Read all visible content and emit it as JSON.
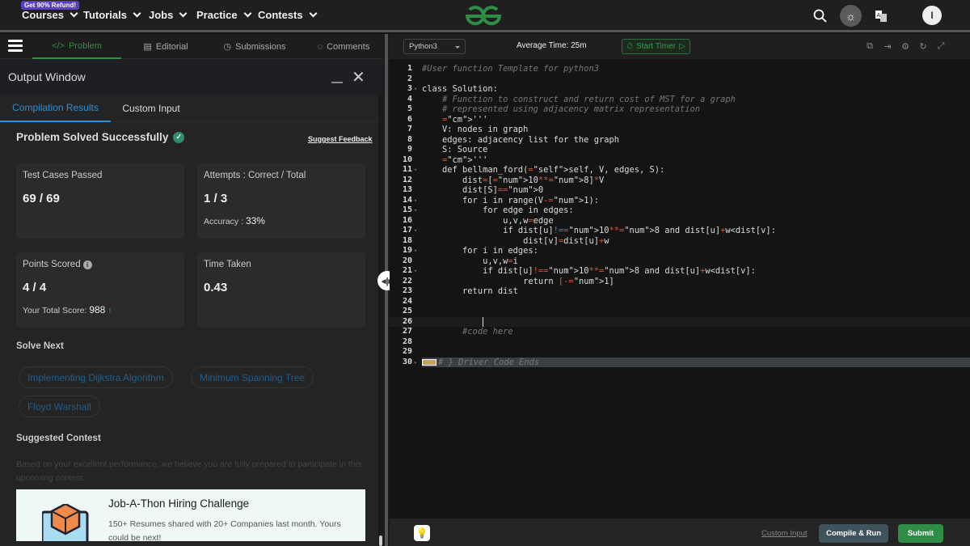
{
  "topnav": {
    "badge": "Get 90% Refund!",
    "items": [
      {
        "label": "Courses"
      },
      {
        "label": "Tutorials"
      },
      {
        "label": "Jobs"
      },
      {
        "label": "Practice"
      },
      {
        "label": "Contests"
      }
    ],
    "avatar_initial": "I",
    "brand_color": "#2f8d46"
  },
  "problem_tabs": [
    {
      "label": "Problem",
      "icon": "code-icon",
      "active": true
    },
    {
      "label": "Editorial",
      "icon": "document-icon"
    },
    {
      "label": "Submissions",
      "icon": "clock-icon"
    },
    {
      "label": "Comments",
      "icon": "comment-icon"
    }
  ],
  "output_window": {
    "title": "Output Window",
    "tabs": [
      {
        "label": "Compilation Results",
        "active": true
      },
      {
        "label": "Custom Input"
      }
    ],
    "status": "Problem Solved Successfully",
    "suggest_feedback": "Suggest Feedback",
    "cards": {
      "test_cases": {
        "label": "Test Cases Passed",
        "value": "69 / 69"
      },
      "attempts": {
        "label": "Attempts : Correct / Total",
        "value": "1 / 3",
        "accuracy_label": "Accuracy :",
        "accuracy_value": "33%"
      },
      "points": {
        "label": "Points Scored",
        "value": "4 / 4",
        "total_label": "Your Total Score:",
        "total_value": "988"
      },
      "time": {
        "label": "Time Taken",
        "value": "0.43"
      }
    },
    "solve_next": {
      "title": "Solve Next",
      "items": [
        "Implementing Dijkstra Algorithm",
        "Minimum Spanning Tree",
        "Floyd Warshall"
      ]
    },
    "suggested_contest": {
      "title": "Suggested Contest",
      "description": "Based on your excellent performance, we believe you are fully prepared to participate in this upcoming contest.",
      "contest_title": "Job-A-Thon Hiring Challenge",
      "contest_text": "150+ Resumes shared with 20+ Companies last month. Yours could be next!"
    }
  },
  "editor": {
    "language": "Python3",
    "average_time": "Average Time: 25m",
    "start_timer": "Start Timer",
    "lines": [
      "#User function Template for python3",
      "",
      "class Solution:",
      "    # Function to construct and return cost of MST for a graph",
      "    # represented using adjacency matrix representation",
      "    '''",
      "    V: nodes in graph",
      "    edges: adjacency list for the graph",
      "    S: Source",
      "    '''",
      "    def bellman_ford(self, V, edges, S):",
      "        dist=[10**8]*V",
      "        dist[S]=0",
      "        for i in range(V-1):",
      "            for edge in edges:",
      "                u,v,w=edge",
      "                if dist[u]!=10**8 and dist[u]+w<dist[v]:",
      "                    dist[v]=dist[u]+w",
      "        for i in edges:",
      "            u,v,w=i",
      "            if dist[u]!=10**8 and dist[u]+w<dist[v]:",
      "                    return [-1]",
      "        return dist",
      "",
      "",
      "            ",
      "        #code here",
      "",
      "",
      "# } Driver Code Ends"
    ],
    "fold_lines": [
      3,
      11,
      14,
      15,
      17,
      19,
      21,
      30
    ],
    "active_line": 26
  },
  "footer": {
    "custom_input": "Custom Input",
    "compile_run": "Compile & Run",
    "submit": "Submit"
  }
}
